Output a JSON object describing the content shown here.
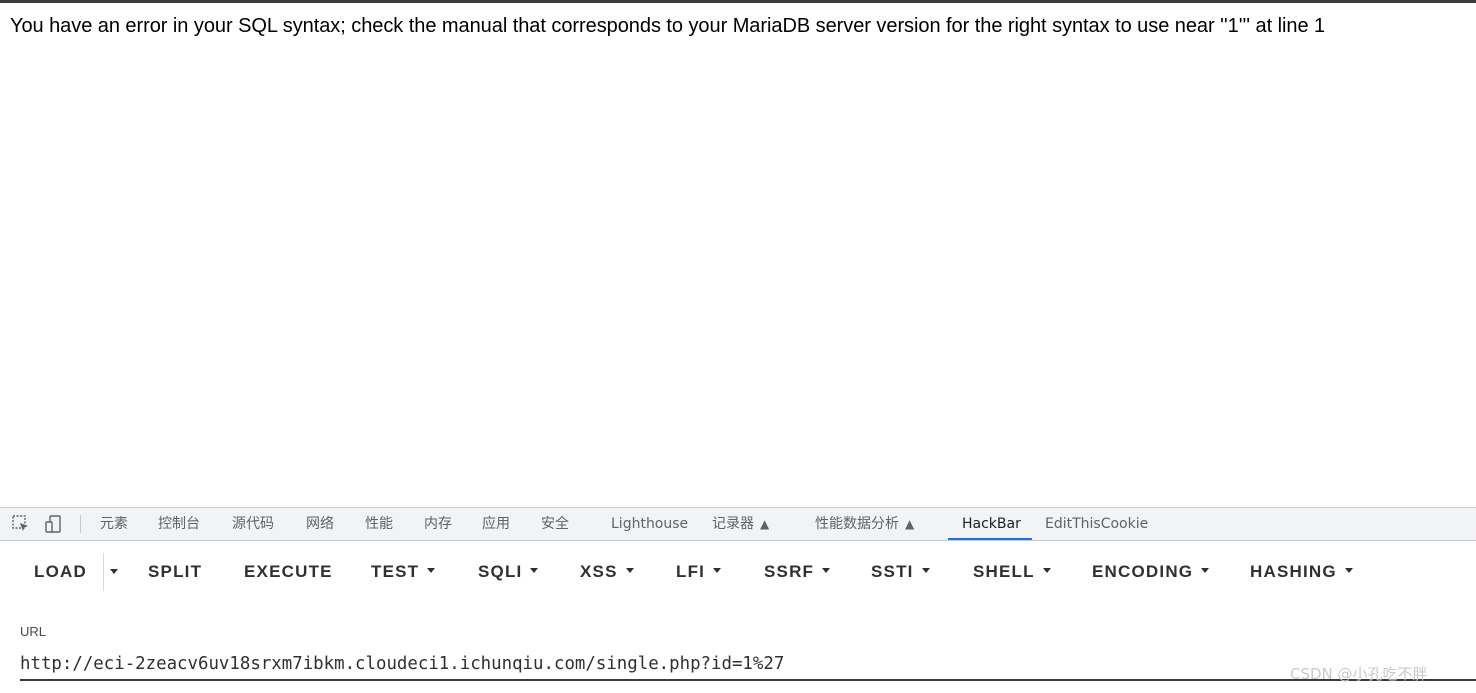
{
  "page": {
    "error_message": "You have an error in your SQL syntax; check the manual that corresponds to your MariaDB server version for the right syntax to use near ''1''' at line 1"
  },
  "devtools": {
    "icons": [
      "inspect-element-icon",
      "device-toolbar-icon"
    ],
    "tabs": [
      {
        "label": "元素"
      },
      {
        "label": "控制台"
      },
      {
        "label": "源代码"
      },
      {
        "label": "网络"
      },
      {
        "label": "性能"
      },
      {
        "label": "内存"
      },
      {
        "label": "应用"
      },
      {
        "label": "安全"
      },
      {
        "label": "Lighthouse"
      },
      {
        "label": "记录器"
      },
      {
        "label": "性能数据分析"
      },
      {
        "label": "HackBar"
      },
      {
        "label": "EditThisCookie"
      }
    ],
    "active_tab": "HackBar",
    "active_color": "#1a73e8"
  },
  "hackbar": {
    "buttons": [
      {
        "label": "LOAD"
      },
      {
        "label": "SPLIT"
      },
      {
        "label": "EXECUTE"
      },
      {
        "label": "TEST"
      },
      {
        "label": "SQLI"
      },
      {
        "label": "XSS"
      },
      {
        "label": "LFI"
      },
      {
        "label": "SSRF"
      },
      {
        "label": "SSTI"
      },
      {
        "label": "SHELL"
      },
      {
        "label": "ENCODING"
      },
      {
        "label": "HASHING"
      }
    ],
    "url_label": "URL",
    "url_value": "http://eci-2zeacv6uv18srxm7ibkm.cloudeci1.ichunqiu.com/single.php?id=1%27"
  },
  "watermark": "CSDN @小孔吃不胖"
}
